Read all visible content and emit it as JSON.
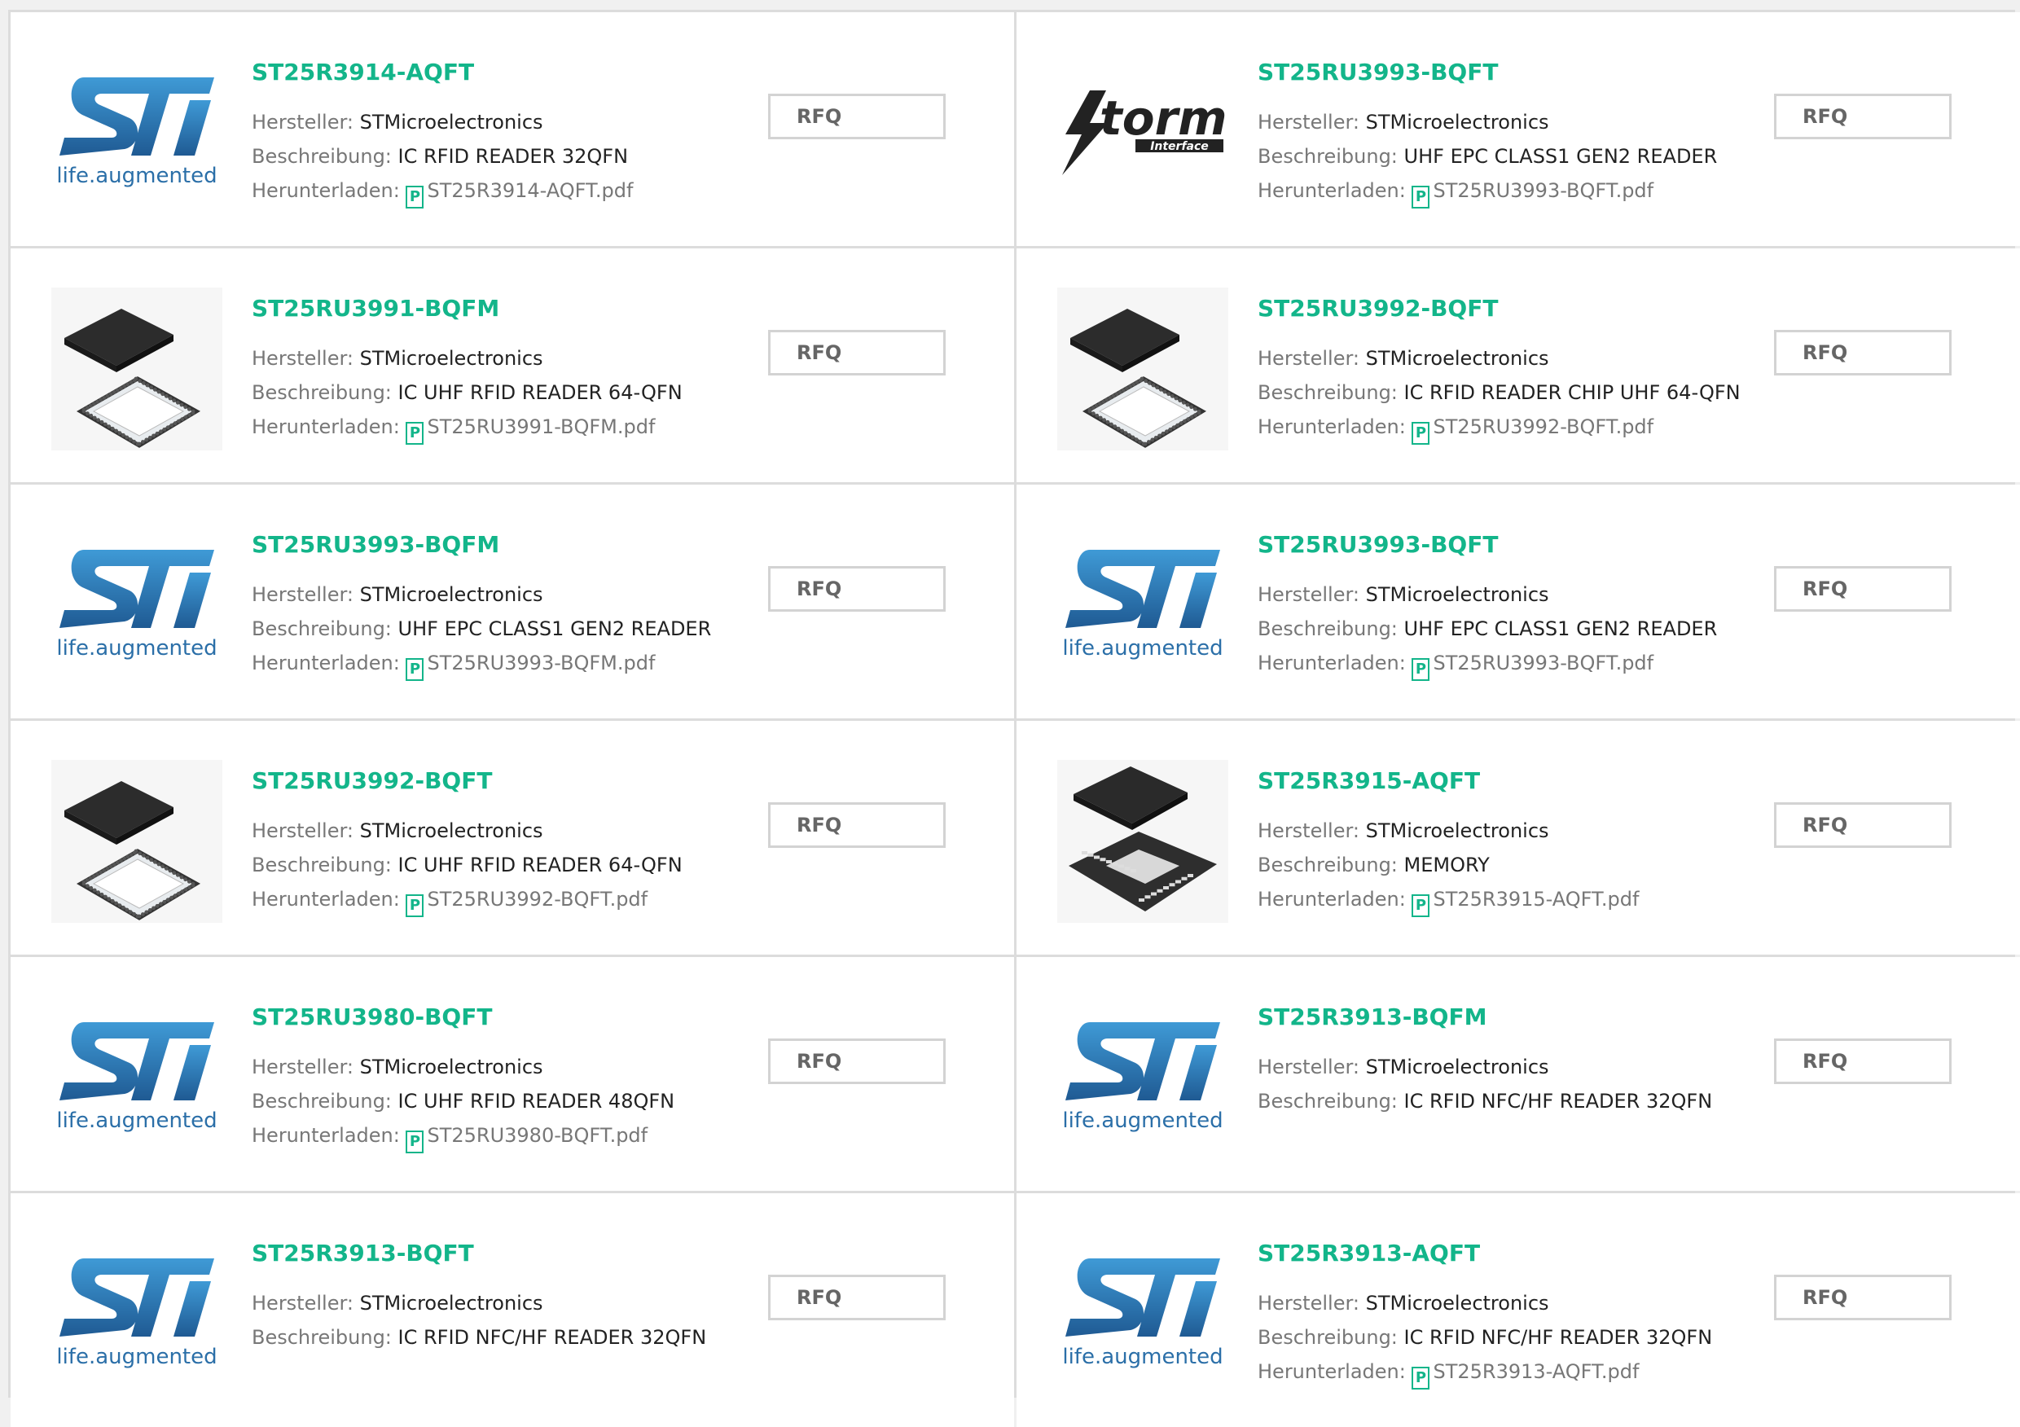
{
  "labels": {
    "manufacturer": "Hersteller: ",
    "description": "Beschreibung: ",
    "download": "Herunterladen: ",
    "rfq": "RFQ",
    "pdf_glyph": "P",
    "st_tagline_1": "life",
    "st_tagline_dot": ".",
    "st_tagline_2": "augmented",
    "storm_text": "torm",
    "storm_sub": "Interface"
  },
  "colors": {
    "accent": "#13b58a",
    "st_blue": "#2b6fa8",
    "border": "#dcdcdc"
  },
  "products": [
    {
      "pn": "ST25R3914-AQFT",
      "manufacturer": "STMicroelectronics",
      "description": "IC RFID READER 32QFN",
      "download": "ST25R3914-AQFT.pdf",
      "image": "st-logo"
    },
    {
      "pn": "ST25RU3993-BQFT",
      "manufacturer": "STMicroelectronics",
      "description": "UHF EPC CLASS1 GEN2 READER",
      "download": "ST25RU3993-BQFT.pdf",
      "image": "storm-logo"
    },
    {
      "pn": "ST25RU3991-BQFM",
      "manufacturer": "STMicroelectronics",
      "description": "IC UHF RFID READER 64-QFN",
      "download": "ST25RU3991-BQFM.pdf",
      "image": "qfn64-chip"
    },
    {
      "pn": "ST25RU3992-BQFT",
      "manufacturer": "STMicroelectronics",
      "description": "IC RFID READER CHIP UHF 64-QFN",
      "download": "ST25RU3992-BQFT.pdf",
      "image": "qfn64-chip"
    },
    {
      "pn": "ST25RU3993-BQFM",
      "manufacturer": "STMicroelectronics",
      "description": "UHF EPC CLASS1 GEN2 READER",
      "download": "ST25RU3993-BQFM.pdf",
      "image": "st-logo"
    },
    {
      "pn": "ST25RU3993-BQFT",
      "manufacturer": "STMicroelectronics",
      "description": "UHF EPC CLASS1 GEN2 READER",
      "download": "ST25RU3993-BQFT.pdf",
      "image": "st-logo"
    },
    {
      "pn": "ST25RU3992-BQFT",
      "manufacturer": "STMicroelectronics",
      "description": "IC UHF RFID READER 64-QFN",
      "download": "ST25RU3992-BQFT.pdf",
      "image": "qfn64-chip"
    },
    {
      "pn": "ST25R3915-AQFT",
      "manufacturer": "STMicroelectronics",
      "description": "MEMORY",
      "download": "ST25R3915-AQFT.pdf",
      "image": "qfn32-chip"
    },
    {
      "pn": "ST25RU3980-BQFT",
      "manufacturer": "STMicroelectronics",
      "description": "IC UHF RFID READER 48QFN",
      "download": "ST25RU3980-BQFT.pdf",
      "image": "st-logo"
    },
    {
      "pn": "ST25R3913-BQFM",
      "manufacturer": "STMicroelectronics",
      "description": "IC RFID NFC/HF READER 32QFN",
      "download": null,
      "image": "st-logo"
    },
    {
      "pn": "ST25R3913-BQFT",
      "manufacturer": "STMicroelectronics",
      "description": "IC RFID NFC/HF READER 32QFN",
      "download": null,
      "image": "st-logo"
    },
    {
      "pn": "ST25R3913-AQFT",
      "manufacturer": "STMicroelectronics",
      "description": "IC RFID NFC/HF READER 32QFN",
      "download": "ST25R3913-AQFT.pdf",
      "image": "st-logo"
    }
  ]
}
